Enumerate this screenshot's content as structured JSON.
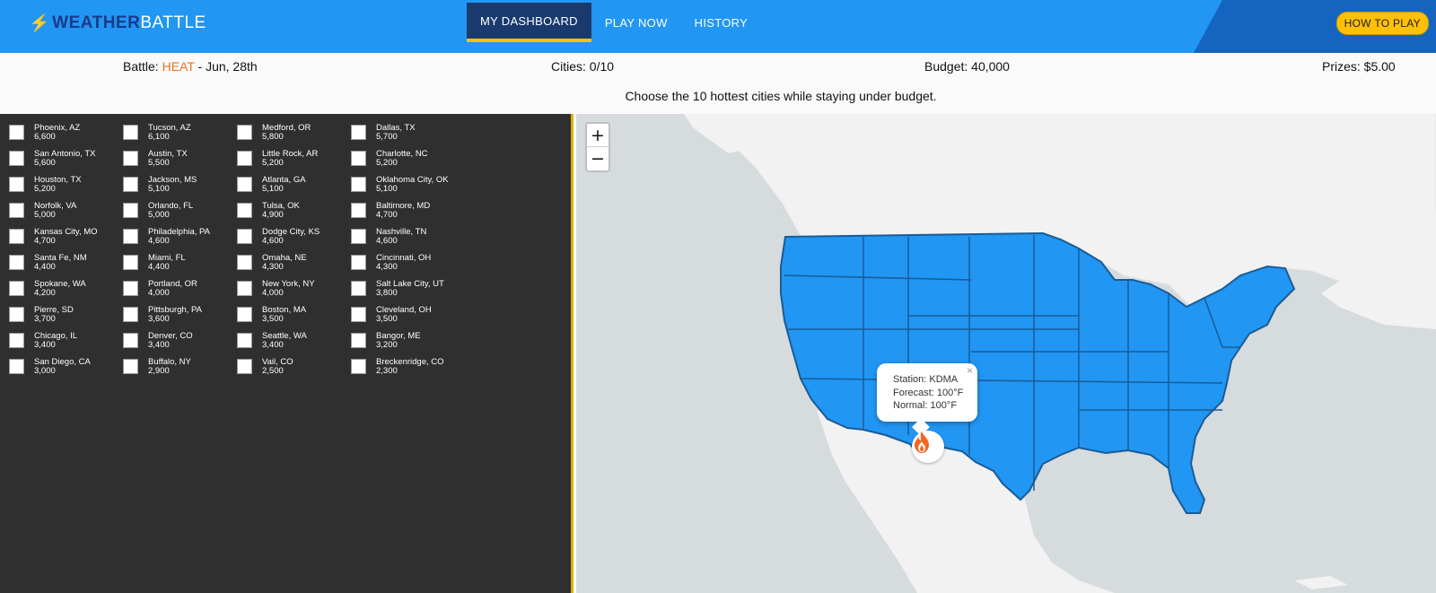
{
  "header": {
    "logo_part1": "WEATHER",
    "logo_part2": "BATTLE",
    "nav": [
      "MY DASHBOARD",
      "PLAY NOW",
      "HISTORY"
    ],
    "how_to_play": "HOW TO PLAY"
  },
  "info": {
    "battle_label": "Battle:",
    "battle_type": "HEAT",
    "battle_date": "- Jun, 28th",
    "cities": "Cities: 0/10",
    "budget": "Budget: 40,000",
    "prizes": "Prizes: $5.00",
    "instruction": "Choose the 10 hottest cities while staying under budget."
  },
  "cities": [
    [
      {
        "name": "Phoenix, AZ",
        "cost": "6,600"
      },
      {
        "name": "San Antonio, TX",
        "cost": "5,600"
      },
      {
        "name": "Houston, TX",
        "cost": "5,200"
      },
      {
        "name": "Norfolk, VA",
        "cost": "5,000"
      },
      {
        "name": "Kansas City, MO",
        "cost": "4,700"
      },
      {
        "name": "Santa Fe, NM",
        "cost": "4,400"
      },
      {
        "name": "Spokane, WA",
        "cost": "4,200"
      },
      {
        "name": "Pierre, SD",
        "cost": "3,700"
      },
      {
        "name": "Chicago, IL",
        "cost": "3,400"
      },
      {
        "name": "San Diego, CA",
        "cost": "3,000"
      }
    ],
    [
      {
        "name": "Tucson, AZ",
        "cost": "6,100"
      },
      {
        "name": "Austin, TX",
        "cost": "5,500"
      },
      {
        "name": "Jackson, MS",
        "cost": "5,100"
      },
      {
        "name": "Orlando, FL",
        "cost": "5,000"
      },
      {
        "name": "Philadelphia, PA",
        "cost": "4,600"
      },
      {
        "name": "Miami, FL",
        "cost": "4,400"
      },
      {
        "name": "Portland, OR",
        "cost": "4,000"
      },
      {
        "name": "Pittsburgh, PA",
        "cost": "3,600"
      },
      {
        "name": "Denver, CO",
        "cost": "3,400"
      },
      {
        "name": "Buffalo, NY",
        "cost": "2,900"
      }
    ],
    [
      {
        "name": "Medford, OR",
        "cost": "5,800"
      },
      {
        "name": "Little Rock, AR",
        "cost": "5,200"
      },
      {
        "name": "Atlanta, GA",
        "cost": "5,100"
      },
      {
        "name": "Tulsa, OK",
        "cost": "4,900"
      },
      {
        "name": "Dodge City, KS",
        "cost": "4,600"
      },
      {
        "name": "Omaha, NE",
        "cost": "4,300"
      },
      {
        "name": "New York, NY",
        "cost": "4,000"
      },
      {
        "name": "Boston, MA",
        "cost": "3,500"
      },
      {
        "name": "Seattle, WA",
        "cost": "3,400"
      },
      {
        "name": "Vail, CO",
        "cost": "2,500"
      }
    ],
    [
      {
        "name": "Dallas, TX",
        "cost": "5,700"
      },
      {
        "name": "Charlotte, NC",
        "cost": "5,200"
      },
      {
        "name": "Oklahoma City, OK",
        "cost": "5,100"
      },
      {
        "name": "Baltimore, MD",
        "cost": "4,700"
      },
      {
        "name": "Nashville, TN",
        "cost": "4,600"
      },
      {
        "name": "Cincinnati, OH",
        "cost": "4,300"
      },
      {
        "name": "Salt Lake City, UT",
        "cost": "3,800"
      },
      {
        "name": "Cleveland, OH",
        "cost": "3,500"
      },
      {
        "name": "Bangor, ME",
        "cost": "3,200"
      },
      {
        "name": "Breckenridge, CO",
        "cost": "2,300"
      }
    ]
  ],
  "map": {
    "zoom_in": "+",
    "zoom_out": "−",
    "popup": {
      "station": "Station: KDMA",
      "forecast": "Forecast: 100°F",
      "normal": "Normal: 100°F",
      "close": "×"
    },
    "marker_icon": "flame-icon",
    "state_color": "#2196f3",
    "land_color": "#f2f2f2",
    "water_color": "#d6dbdd"
  }
}
